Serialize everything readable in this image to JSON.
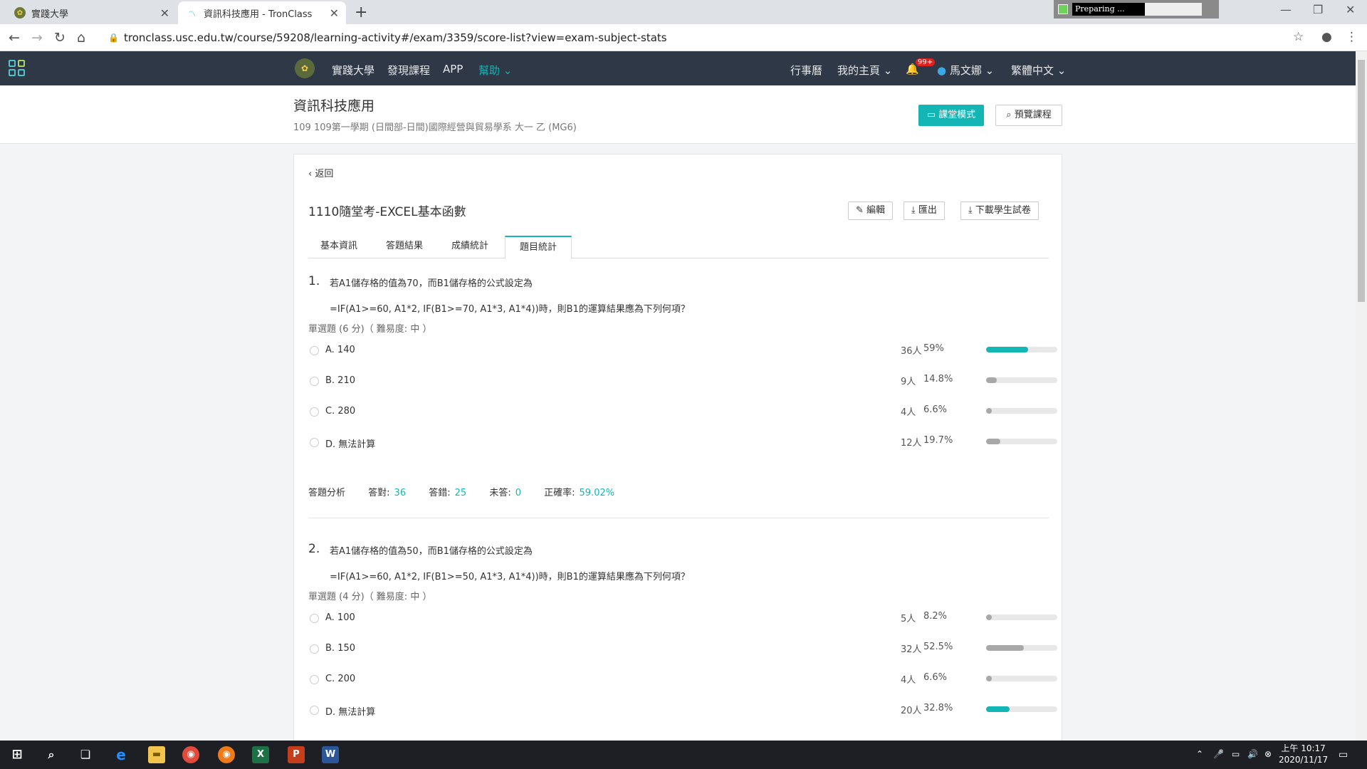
{
  "browser": {
    "tabs": [
      {
        "title": "實踐大學"
      },
      {
        "title": "資訊科技應用 - TronClass"
      }
    ],
    "url": "tronclass.usc.edu.tw/course/59208/learning-activity#/exam/3359/score-list?view=exam-subject-stats",
    "preparing": "Preparing ..."
  },
  "topnav": {
    "school": "實踐大學",
    "discover": "發現課程",
    "app": "APP",
    "help": "幫助",
    "calendar": "行事曆",
    "home": "我的主頁",
    "badge": "99+",
    "user": "馬文娜",
    "lang": "繁體中文"
  },
  "course": {
    "title": "資訊科技應用",
    "subtitle": "109 109第一學期 (日間部-日間)國際經營與貿易學系 大一 乙 (MG6)",
    "class_mode": "課堂模式",
    "preview": "預覽課程"
  },
  "exam": {
    "back": "返回",
    "title": "1110隨堂考-EXCEL基本函數",
    "edit": "編輯",
    "export": "匯出",
    "download": "下載學生試卷",
    "tabs": [
      "基本資訊",
      "答題結果",
      "成績統計",
      "題目統計"
    ]
  },
  "colors": {
    "accent": "#14b5b5",
    "bar_gray": "#a8a8a8"
  },
  "questions": [
    {
      "num": "1.",
      "line1": "若A1儲存格的值為70，而B1儲存格的公式設定為",
      "line2": "=IF(A1>=60, A1*2, IF(B1>=70, A1*3, A1*4))時，則B1的運算結果應為下列何項？",
      "type": "單選題 (6 分)（ 難易度: 中 ）",
      "options": [
        {
          "label": "A.  140",
          "count": "36人",
          "pct": "59%",
          "value": 59,
          "correct": true
        },
        {
          "label": "B.  210",
          "count": "9人",
          "pct": "14.8%",
          "value": 14.8,
          "correct": false
        },
        {
          "label": "C.  280",
          "count": "4人",
          "pct": "6.6%",
          "value": 6.6,
          "correct": false
        },
        {
          "label": "D.  無法計算",
          "count": "12人",
          "pct": "19.7%",
          "value": 19.7,
          "correct": false
        }
      ],
      "stats": {
        "label": "答題分析",
        "right_l": "答對:",
        "right": "36",
        "wrong_l": "答錯:",
        "wrong": "25",
        "none_l": "未答:",
        "none": "0",
        "rate_l": "正確率:",
        "rate": "59.02%"
      }
    },
    {
      "num": "2.",
      "line1": "若A1儲存格的值為50，而B1儲存格的公式設定為",
      "line2": "=IF(A1>=60, A1*2, IF(B1>=50, A1*3, A1*4))時，則B1的運算結果應為下列何項？",
      "type": "單選題 (4 分)（ 難易度: 中 ）",
      "options": [
        {
          "label": "A.  100",
          "count": "5人",
          "pct": "8.2%",
          "value": 8.2,
          "correct": false
        },
        {
          "label": "B.  150",
          "count": "32人",
          "pct": "52.5%",
          "value": 52.5,
          "correct": false
        },
        {
          "label": "C.  200",
          "count": "4人",
          "pct": "6.6%",
          "value": 6.6,
          "correct": false
        },
        {
          "label": "D.  無法計算",
          "count": "20人",
          "pct": "32.8%",
          "value": 32.8,
          "correct": true
        }
      ]
    }
  ],
  "taskbar": {
    "time": "上午 10:17",
    "date": "2020/11/17"
  }
}
